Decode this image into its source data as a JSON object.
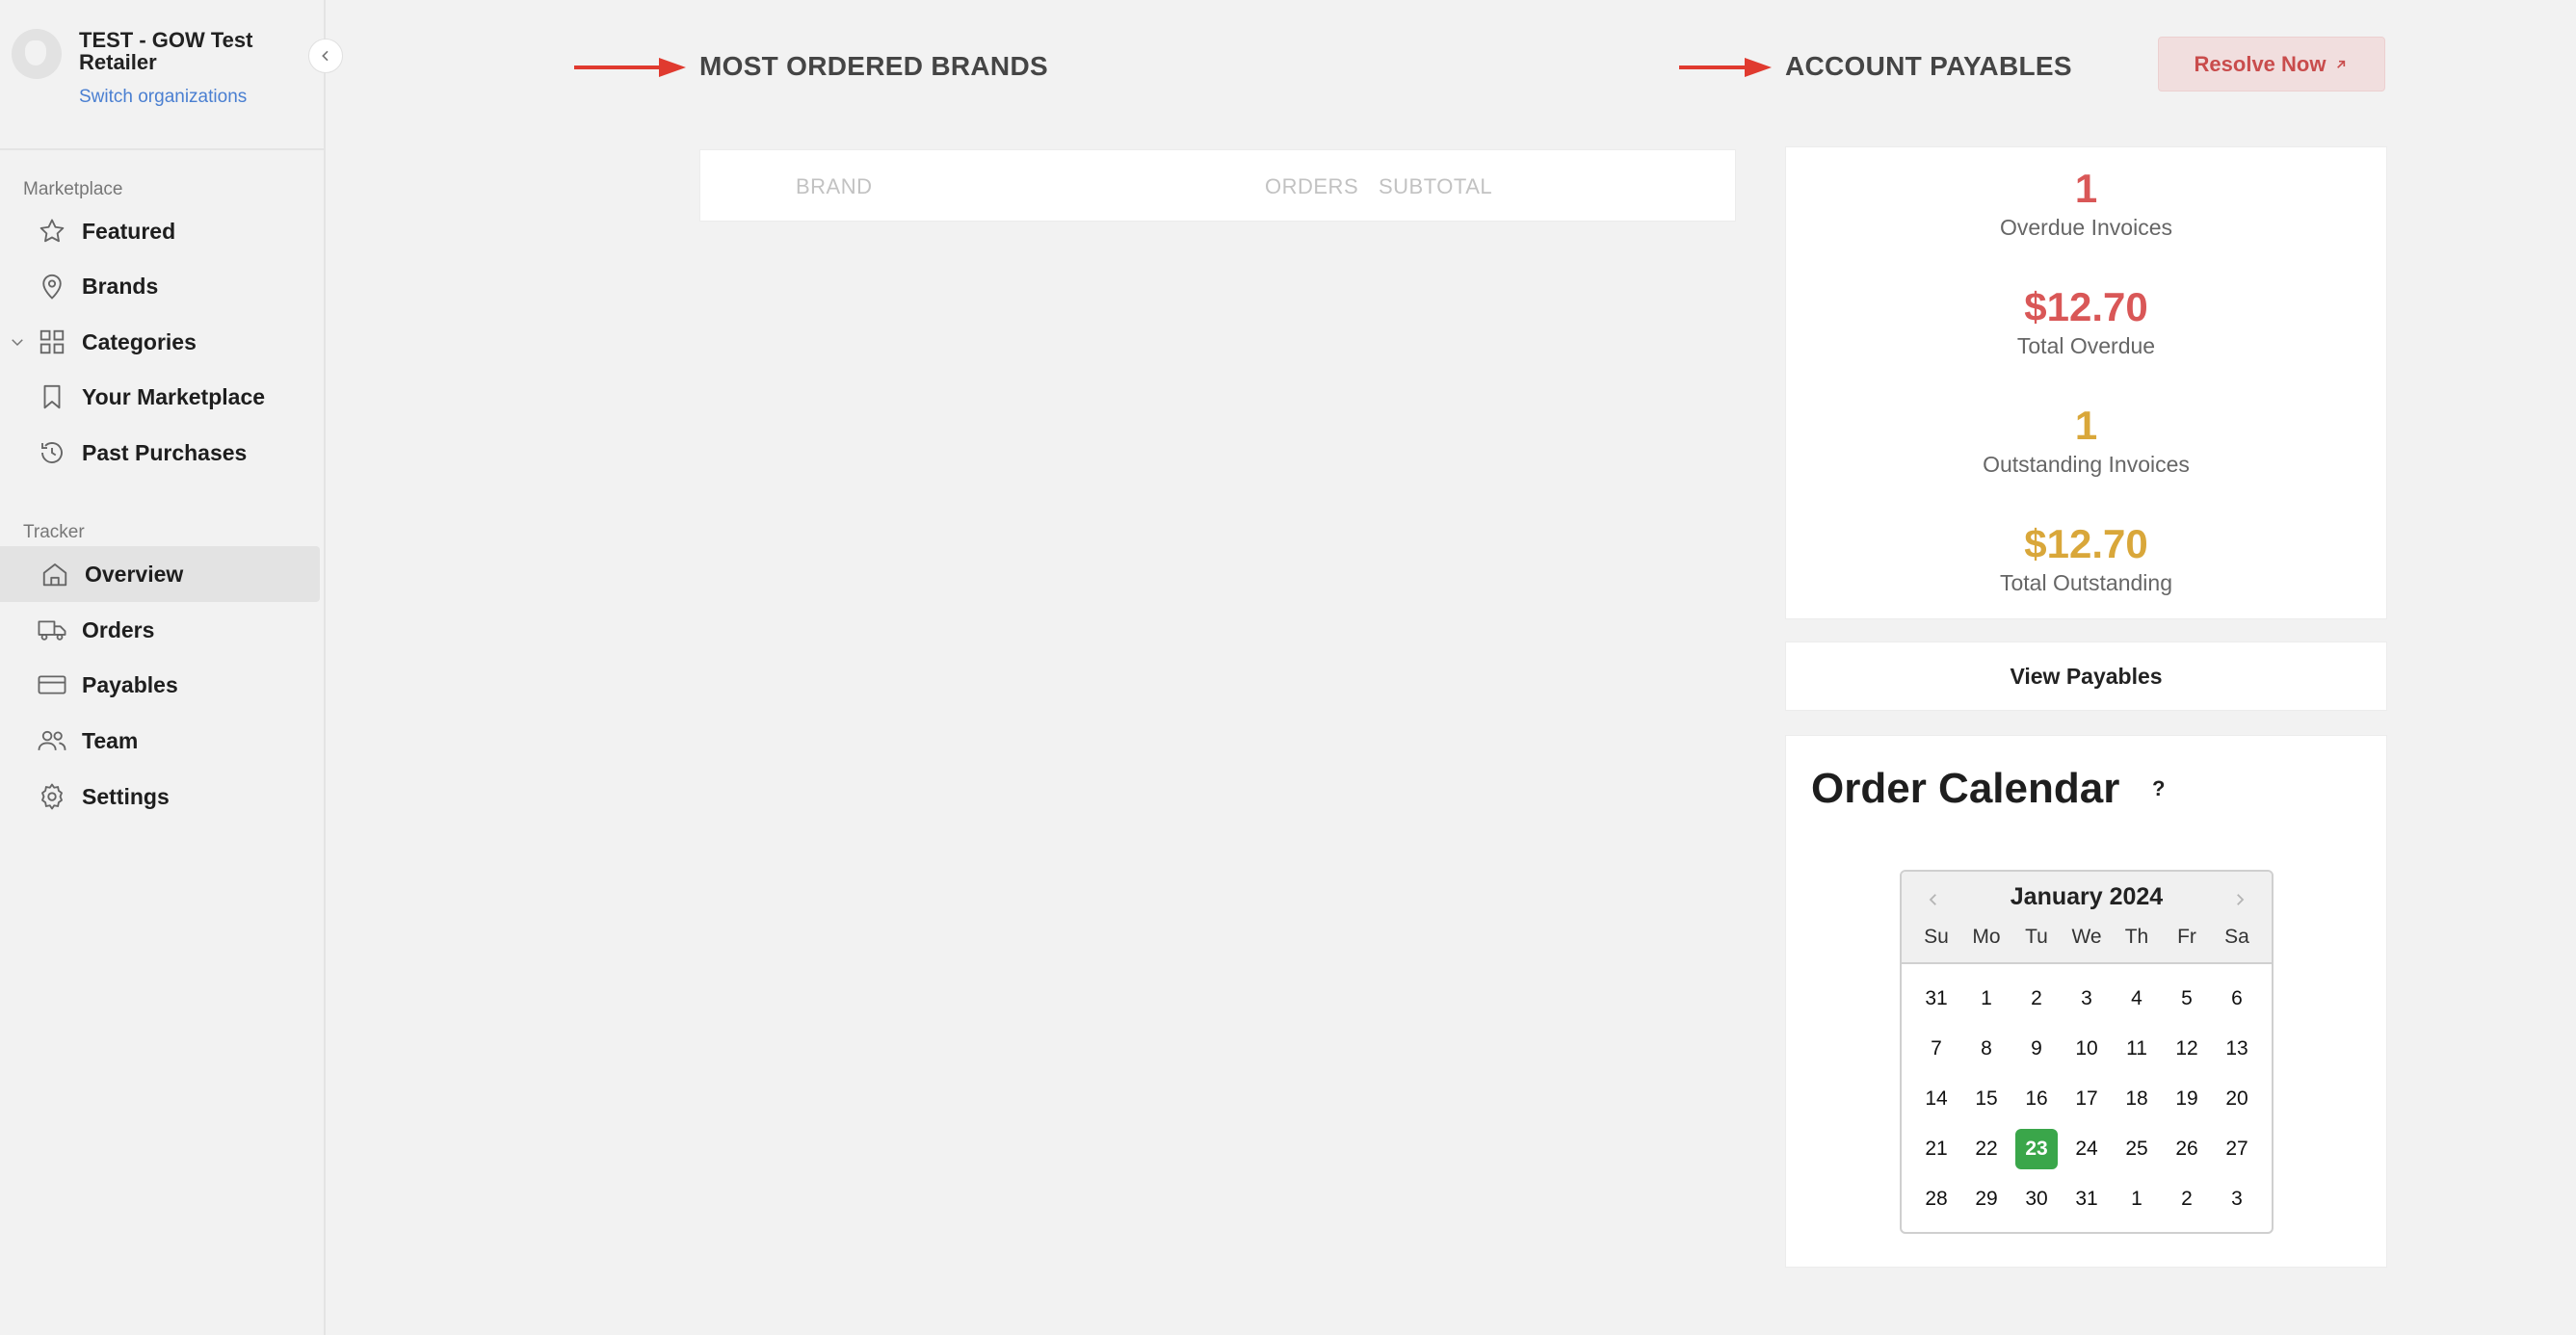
{
  "org": {
    "name": "TEST - GOW Test Retailer",
    "switch_label": "Switch organizations"
  },
  "sidebar": {
    "marketplace_label": "Marketplace",
    "marketplace_items": [
      {
        "label": "Featured",
        "icon": "star-icon"
      },
      {
        "label": "Brands",
        "icon": "map-pin-icon"
      },
      {
        "label": "Categories",
        "icon": "grid-icon"
      },
      {
        "label": "Your Marketplace",
        "icon": "bookmark-icon"
      },
      {
        "label": "Past Purchases",
        "icon": "history-icon"
      }
    ],
    "tracker_label": "Tracker",
    "tracker_items": [
      {
        "label": "Overview",
        "icon": "home-icon",
        "active": true
      },
      {
        "label": "Orders",
        "icon": "truck-icon"
      },
      {
        "label": "Payables",
        "icon": "credit-card-icon"
      },
      {
        "label": "Team",
        "icon": "users-icon"
      },
      {
        "label": "Settings",
        "icon": "gear-icon"
      }
    ]
  },
  "brands": {
    "title": "MOST ORDERED BRANDS",
    "columns": [
      "BRAND",
      "ORDERS",
      "SUBTOTAL"
    ]
  },
  "payables": {
    "title": "ACCOUNT PAYABLES",
    "resolve_label": "Resolve Now",
    "metrics": [
      {
        "value": "1",
        "label": "Overdue Invoices",
        "color": "#d95757"
      },
      {
        "value": "$12.70",
        "label": "Total Overdue",
        "color": "#d95757"
      },
      {
        "value": "1",
        "label": "Outstanding Invoices",
        "color": "#d9a73a"
      },
      {
        "value": "$12.70",
        "label": "Total Outstanding",
        "color": "#d9a73a"
      }
    ],
    "view_label": "View Payables"
  },
  "calendar": {
    "title": "Order Calendar",
    "help": "?",
    "month": "January 2024",
    "weekdays": [
      "Su",
      "Mo",
      "Tu",
      "We",
      "Th",
      "Fr",
      "Sa"
    ],
    "weeks": [
      [
        "31",
        "1",
        "2",
        "3",
        "4",
        "5",
        "6"
      ],
      [
        "7",
        "8",
        "9",
        "10",
        "11",
        "12",
        "13"
      ],
      [
        "14",
        "15",
        "16",
        "17",
        "18",
        "19",
        "20"
      ],
      [
        "21",
        "22",
        "23",
        "24",
        "25",
        "26",
        "27"
      ],
      [
        "28",
        "29",
        "30",
        "31",
        "1",
        "2",
        "3"
      ]
    ],
    "selected": "23"
  }
}
